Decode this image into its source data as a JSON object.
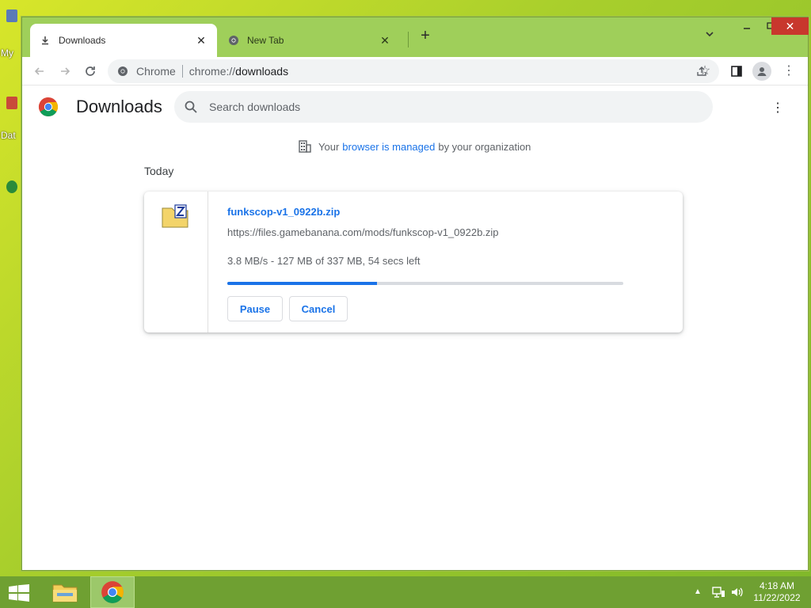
{
  "desktop": {
    "labels": [
      "My",
      "Dat"
    ]
  },
  "browser": {
    "tabs": [
      {
        "label": "Downloads",
        "icon": "download-icon",
        "active": true
      },
      {
        "label": "New Tab",
        "icon": "chrome-icon",
        "active": false
      }
    ],
    "omnibox": {
      "site_name": "Chrome",
      "url_scheme": "chrome://",
      "url_host": "downloads"
    }
  },
  "page": {
    "title": "Downloads",
    "search_placeholder": "Search downloads",
    "managed_prefix": "Your",
    "managed_link": "browser is managed",
    "managed_suffix": "by your organization",
    "section_label": "Today"
  },
  "download": {
    "file_name": "funkscop-v1_0922b.zip",
    "url": "https://files.gamebanana.com/mods/funkscop-v1_0922b.zip",
    "status": "3.8 MB/s - 127 MB of 337 MB, 54 secs left",
    "progress_fraction": 0.377,
    "pause_label": "Pause",
    "cancel_label": "Cancel"
  },
  "taskbar": {
    "time": "4:18 AM",
    "date": "11/22/2022"
  },
  "colors": {
    "accent": "#1a73e8",
    "titlebar": "#9fcf5a",
    "taskbar": "#6fa032",
    "close": "#c8372d"
  }
}
